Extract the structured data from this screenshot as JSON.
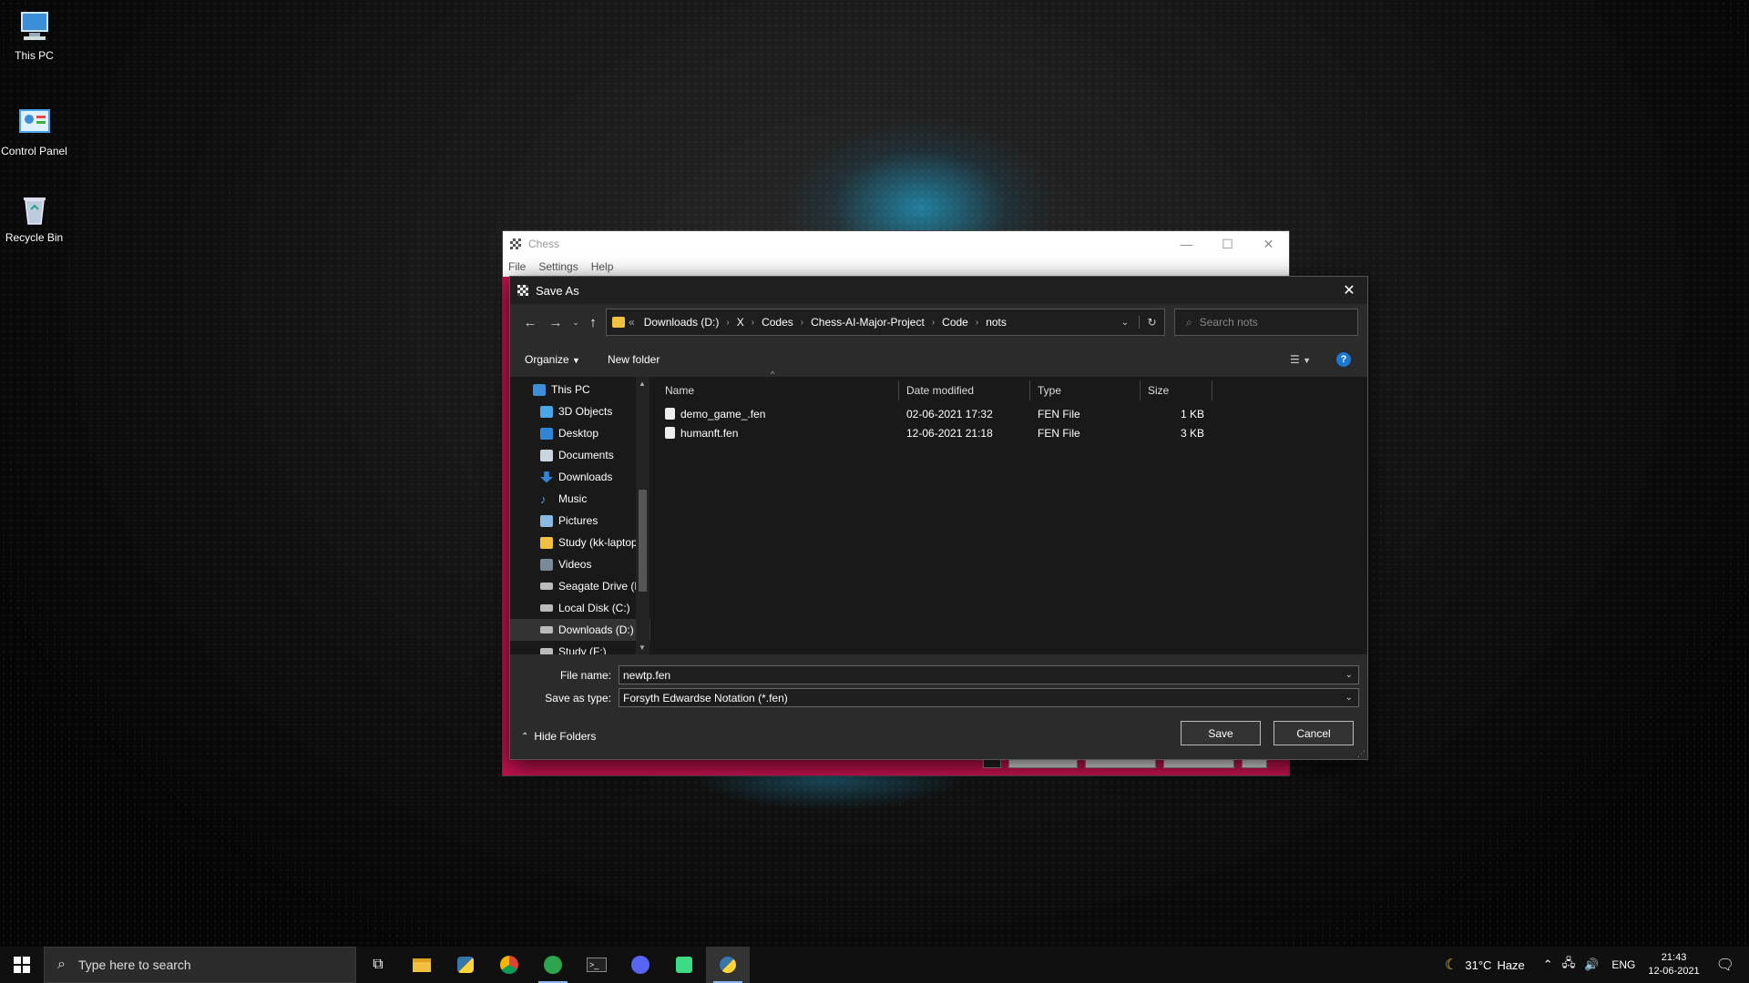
{
  "desktop": {
    "icons": [
      {
        "label": "This PC"
      },
      {
        "label": "Control Panel"
      },
      {
        "label": "Recycle Bin"
      }
    ]
  },
  "chess_window": {
    "title": "Chess",
    "menu": [
      "File",
      "Settings",
      "Help"
    ]
  },
  "dialog": {
    "title": "Save As",
    "breadcrumb": [
      "Downloads (D:)",
      "X",
      "Codes",
      "Chess-AI-Major-Project",
      "Code",
      "nots"
    ],
    "breadcrumb_prefix": "«",
    "search_placeholder": "Search nots",
    "toolbar": {
      "organize": "Organize",
      "new_folder": "New folder"
    },
    "nav": {
      "root": "This PC",
      "items": [
        "3D Objects",
        "Desktop",
        "Documents",
        "Downloads",
        "Music",
        "Pictures",
        "Study (kk-laptop",
        "Videos",
        "Seagate Drive (B",
        "Local Disk (C:)",
        "Downloads (D:)",
        "Study (F:)"
      ],
      "selected": "Downloads (D:)"
    },
    "columns": {
      "name": "Name",
      "date": "Date modified",
      "type": "Type",
      "size": "Size"
    },
    "files": [
      {
        "name": "demo_game_.fen",
        "date": "02-06-2021 17:32",
        "type": "FEN File",
        "size": "1 KB"
      },
      {
        "name": "humanft.fen",
        "date": "12-06-2021 21:18",
        "type": "FEN File",
        "size": "3 KB"
      }
    ],
    "file_name_label": "File name:",
    "file_name_value": "newtp.fen",
    "save_type_label": "Save as type:",
    "save_type_value": "Forsyth Edwardse Notation (*.fen)",
    "hide_folders": "Hide Folders",
    "save_button": "Save",
    "cancel_button": "Cancel"
  },
  "taskbar": {
    "search_placeholder": "Type here to search",
    "weather_temp": "31°C",
    "weather_text": "Haze",
    "language": "ENG",
    "time": "21:43",
    "date": "12-06-2021"
  }
}
